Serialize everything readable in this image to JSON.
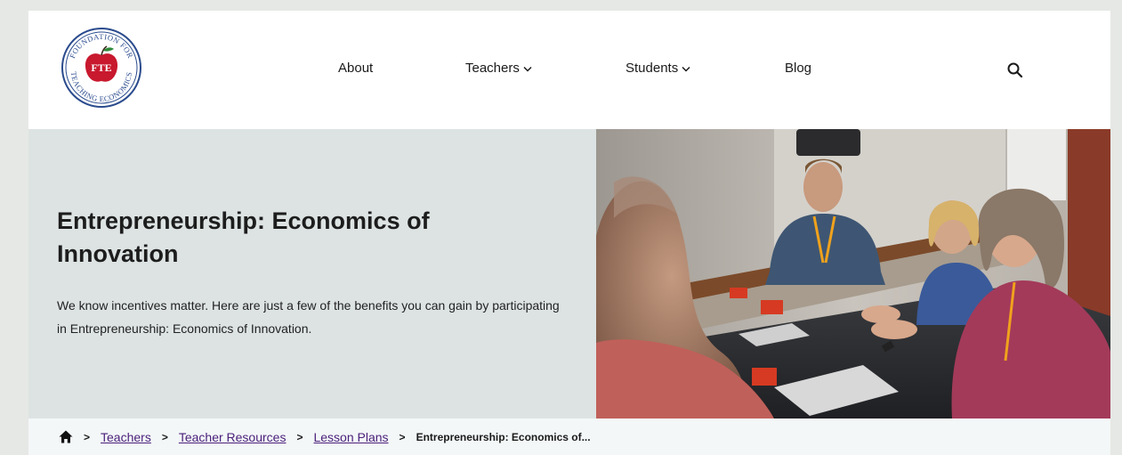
{
  "logo": {
    "ring_text_top": "FOUNDATION FOR",
    "ring_text_bottom": "TEACHING ECONOMICS",
    "badge": "FTE"
  },
  "nav": {
    "items": [
      {
        "label": "About"
      },
      {
        "label": "Teachers"
      },
      {
        "label": "Students"
      },
      {
        "label": "Blog"
      }
    ]
  },
  "hero": {
    "title": "Entrepreneurship: Economics of Innovation",
    "description": "We know incentives matter. Here are just a few of the benefits you can gain by participating in Entrepreneurship: Economics of Innovation."
  },
  "breadcrumb": {
    "items": [
      {
        "label": "Teachers"
      },
      {
        "label": "Teacher Resources"
      },
      {
        "label": "Lesson Plans"
      }
    ],
    "separator": ">",
    "current": "Entrepreneurship: Economics of..."
  },
  "icons": {
    "search": "search-icon",
    "home": "home-icon",
    "chevron": "chevron-down-icon"
  },
  "colors": {
    "hero_bg": "#dde3e3",
    "breadcrumb_bg": "#f3f7f8",
    "link": "#4a1f7a",
    "logo_blue": "#2a4b8d",
    "logo_red": "#c8192e"
  }
}
